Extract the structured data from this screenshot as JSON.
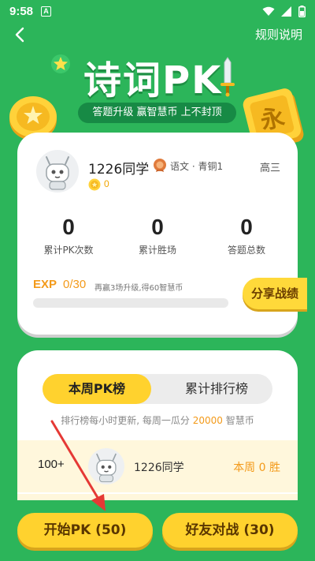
{
  "status_bar": {
    "time": "9:58",
    "notification_icon": "A"
  },
  "header": {
    "rules_label": "规则说明"
  },
  "hero": {
    "title": "诗词PK",
    "subtitle": "答题升级 赢智慧币 上不封顶",
    "tile_char": "永"
  },
  "profile": {
    "name": "1226同学",
    "subject": "语文 · 青铜1",
    "grade": "高三",
    "coins": "0",
    "stats": [
      {
        "value": "0",
        "label": "累计PK次数"
      },
      {
        "value": "0",
        "label": "累计胜场"
      },
      {
        "value": "0",
        "label": "答题总数"
      }
    ],
    "exp_label": "EXP",
    "exp_value": "0/30",
    "exp_progress": 0,
    "exp_hint": "再赢3场升级,得60智慧币",
    "share_label": "分享战绩"
  },
  "ranking": {
    "tabs": [
      {
        "label": "本周PK榜",
        "active": true
      },
      {
        "label": "累计排行榜",
        "active": false
      }
    ],
    "hint_prefix": "排行榜每小时更新, 每周一瓜分",
    "hint_amount": "20000",
    "hint_suffix": "智慧币",
    "rows": [
      {
        "position": "100+",
        "name": "1226同学",
        "wins": "本周 0 胜"
      }
    ]
  },
  "actions": {
    "start_label": "开始PK (50)",
    "friend_label": "好友对战 (30)"
  },
  "colors": {
    "background": "#2cb55a",
    "accent_yellow": "#ffd22e",
    "accent_orange": "#f39a1a",
    "annotation_red": "#e53935"
  }
}
